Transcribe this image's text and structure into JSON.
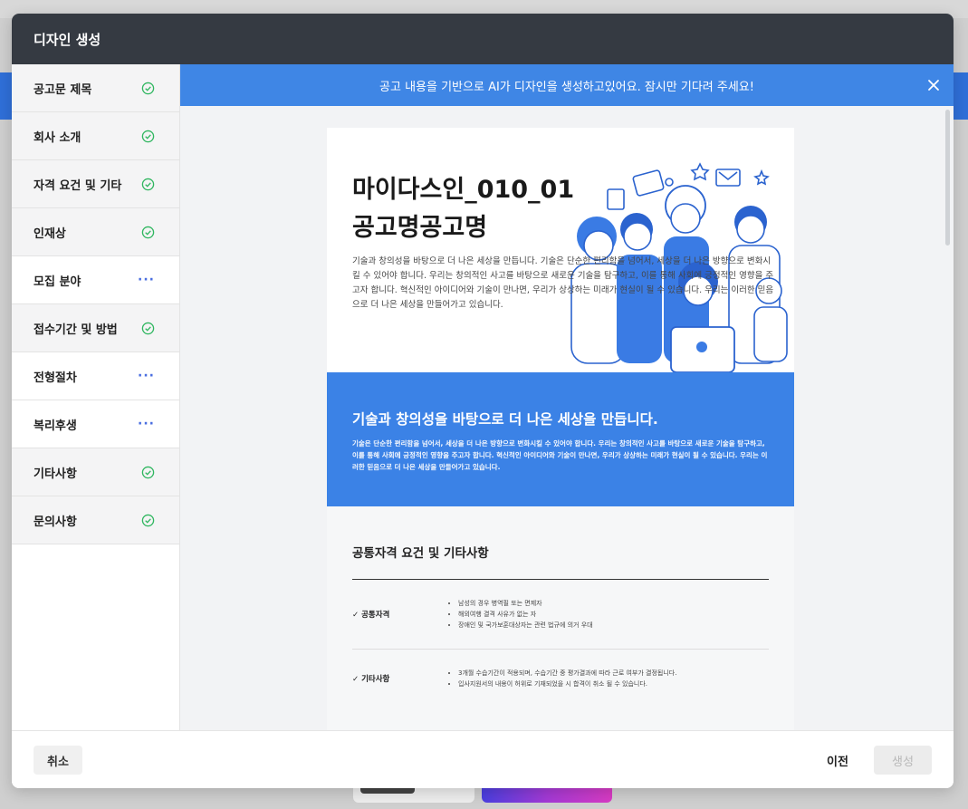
{
  "modal": {
    "title": "디자인 생성"
  },
  "sidebar": {
    "items": [
      {
        "label": "공고문 제목",
        "status": "done"
      },
      {
        "label": "회사 소개",
        "status": "done"
      },
      {
        "label": "자격 요건 및 기타",
        "status": "done"
      },
      {
        "label": "인재상",
        "status": "done"
      },
      {
        "label": "모집 분야",
        "status": "pending"
      },
      {
        "label": "접수기간 및 방법",
        "status": "done"
      },
      {
        "label": "전형절차",
        "status": "pending"
      },
      {
        "label": "복리후생",
        "status": "pending"
      },
      {
        "label": "기타사항",
        "status": "done"
      },
      {
        "label": "문의사항",
        "status": "done"
      }
    ],
    "status_icons": {
      "done": "check-circle-icon",
      "pending": "dots-icon"
    }
  },
  "banner": {
    "text": "공고 내용을 기반으로 AI가 디자인을 생성하고있어요. 잠시만 기다려 주세요!"
  },
  "preview": {
    "hero": {
      "title_line1": "마이다스인_010_01",
      "title_line2": "공고명공고명",
      "text": "기술과 창의성을 바탕으로 더 나은 세상을 만듭니다. 기술은 단순한 편리함을 넘어서, 세상을 더 나은 방향으로 변화시킬 수 있어야 합니다. 우리는 창의적인 사고를 바탕으로 새로운 기술을 탐구하고, 이를 통해 사회에 긍정적인 영향을 주고자 합니다. 혁신적인 아이디어와 기술이 만나면, 우리가 상상하는 미래가 현실이 될 수 있습니다. 우리는 이러한 믿음으로 더 나은 세상을 만들어가고 있습니다."
    },
    "blue": {
      "title": "기술과 창의성을 바탕으로 더 나은 세상을 만듭니다.",
      "text": "기술은 단순한 편리함을 넘어서, 세상을 더 나은 방향으로 변화시킬 수 있어야 합니다. 우리는 창의적인 사고를 바탕으로 새로운 기술을 탐구하고, 이를 통해 사회에 긍정적인 영향을 주고자 합니다. 혁신적인 아이디어와 기술이 만나면, 우리가 상상하는 미래가 현실이 될 수 있습니다. 우리는 이러한 믿음으로 더 나은 세상을 만들어가고 있습니다."
    },
    "requirements": {
      "title": "공통자격 요건 및 기타사항",
      "rows": [
        {
          "label": "✓ 공통자격",
          "items": [
            "남성의 경우 병역필 또는 면제자",
            "해외여행 결격 사유가 없는 자",
            "장애인 및 국가보훈대상자는 관련 법규에 의거 우대"
          ]
        },
        {
          "label": "✓ 기타사항",
          "items": [
            "3개월 수습기간이 적용되며, 수습기간 중 평가결과에 따라 근로 여부가 결정됩니다.",
            "입사지원서의 내용이 허위로 기재되었을 시 합격이 취소 될 수 있습니다."
          ]
        }
      ]
    }
  },
  "footer": {
    "cancel": "취소",
    "prev": "이전",
    "create": "생성"
  },
  "colors": {
    "header": "#353a42",
    "accent": "#3f86e5",
    "check": "#2fb65f",
    "dots": "#4a6ee0"
  }
}
